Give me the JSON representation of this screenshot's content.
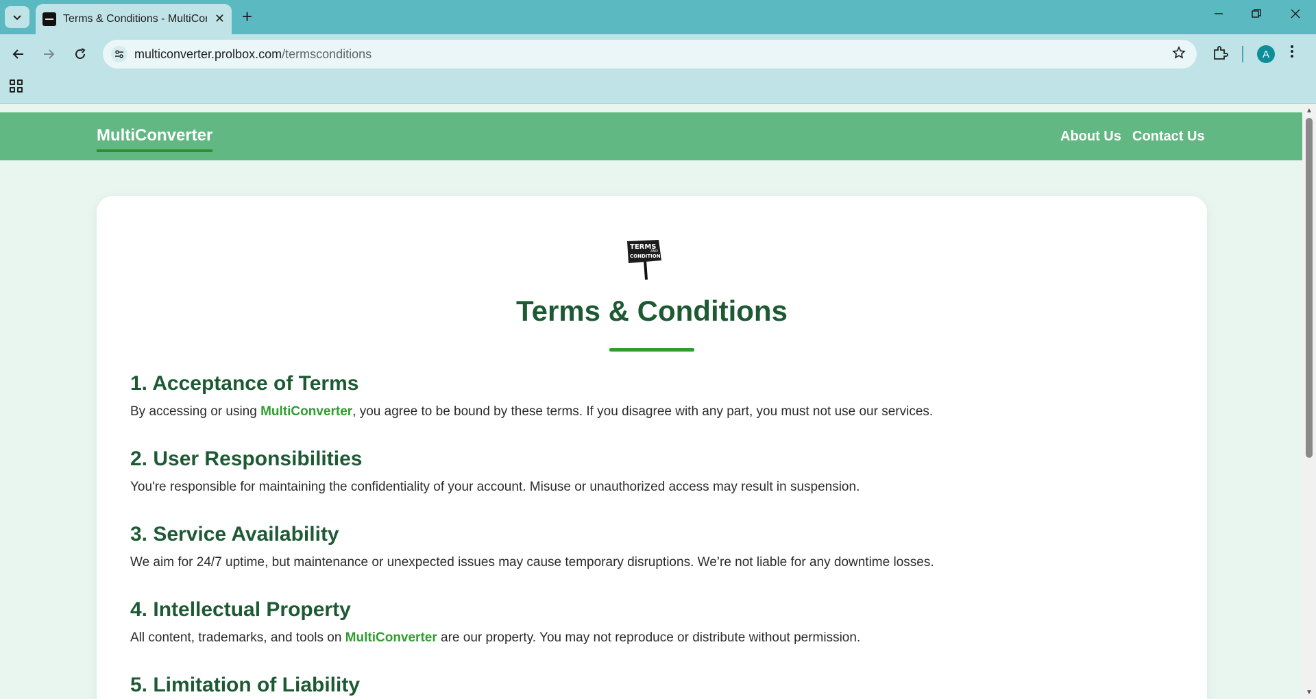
{
  "browser": {
    "tab_title": "Terms & Conditions - MultiConverter",
    "tab_close": "✕",
    "new_tab": "+",
    "url_host": "multiconverter.prolbox.com",
    "url_path": "/termsconditions",
    "avatar_letter": "A",
    "icons": [
      "tab-search-icon",
      "favicon-icon",
      "close-icon",
      "plus-icon",
      "minimize-icon",
      "restore-icon",
      "window-close-icon",
      "back-icon",
      "forward-icon",
      "reload-icon",
      "site-info-icon",
      "star-icon",
      "extensions-icon",
      "menu-icon",
      "apps-icon"
    ]
  },
  "site": {
    "brand": "MultiConverter",
    "nav": [
      "About Us",
      "Contact Us"
    ],
    "accent_color": "#62b882",
    "heading_color": "#1d5a34",
    "link_color": "#2f9e2f"
  },
  "page": {
    "title": "Terms & Conditions",
    "logo_text_line1": "TERMS",
    "logo_text_and": "AND",
    "logo_text_line2": "CONDITIONS",
    "sections": [
      {
        "heading": "1. Acceptance of Terms",
        "text_before": "By accessing or using ",
        "link": "MultiConverter",
        "text_after": ", you agree to be bound by these terms. If you disagree with any part, you must not use our services."
      },
      {
        "heading": "2. User Responsibilities",
        "text": "You're responsible for maintaining the confidentiality of your account. Misuse or unauthorized access may result in suspension."
      },
      {
        "heading": "3. Service Availability",
        "text": "We aim for 24/7 uptime, but maintenance or unexpected issues may cause temporary disruptions. We’re not liable for any downtime losses."
      },
      {
        "heading": "4. Intellectual Property",
        "text_before": "All content, trademarks, and tools on ",
        "link": "MultiConverter",
        "text_after": " are our property. You may not reproduce or distribute without permission."
      },
      {
        "heading": "5. Limitation of Liability"
      }
    ]
  }
}
